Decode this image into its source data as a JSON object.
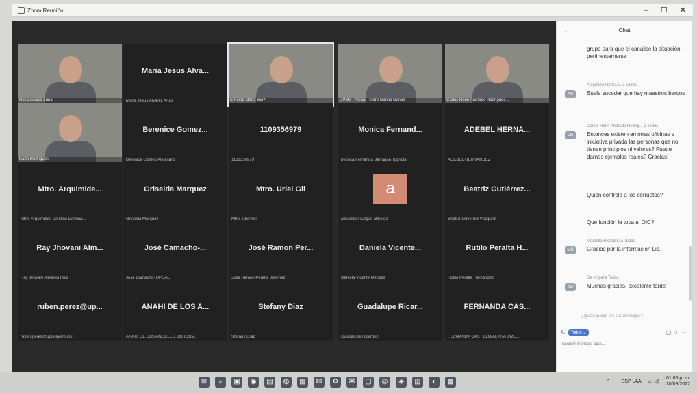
{
  "window": {
    "title": "Zoom Reunión",
    "minimize": "–",
    "maximize": "☐",
    "close": "✕"
  },
  "tiles": [
    {
      "big": "",
      "small": "Rosa Anaisa Luna",
      "video": true
    },
    {
      "big": "Maria Jesus Alva...",
      "small": "Maria Jesus Alvarez Arias",
      "video": false
    },
    {
      "big": "",
      "small": "Ernesto Mena SEP",
      "video": true,
      "active": true
    },
    {
      "big": "",
      "small": "UPSM - Alvaro Pedro Garcia Garcia",
      "video": true
    },
    {
      "big": "",
      "small": "Carlos René Andrade Rodrigues...",
      "video": true
    },
    {
      "big": "",
      "small": "Karla Rodrigues",
      "video": true
    },
    {
      "big": "Berenice Gomez...",
      "small": "Berenice Gomez Alejandro",
      "video": false
    },
    {
      "big": "1109356979",
      "small": "1109356979",
      "video": false
    },
    {
      "big": "Monica Fernand...",
      "small": "Monica Fernanda Barragan Tognola",
      "video": false
    },
    {
      "big": "ADEBEL HERNA...",
      "small": "ADEBEL HERNANDEZ",
      "video": false
    },
    {
      "big": "Mtro. Arquimide...",
      "small": "Mtro. Arquimides De Dios Domina...",
      "video": false
    },
    {
      "big": "Griselda Marquez",
      "small": "Griselda Márquez",
      "video": false
    },
    {
      "big": "Mtro. Uriel Gil",
      "small": "Mtro. Uriel Gil",
      "video": false
    },
    {
      "big": "",
      "small": "alexander vargas almeida",
      "video": false,
      "avatar": "a"
    },
    {
      "big": "Beatriz Gutiérrez...",
      "small": "Beatriz Gutiérrez Vázquez",
      "video": false
    },
    {
      "big": "Ray Jhovani Alm...",
      "small": "Ray Jhovani Almeida Ruiz",
      "video": false
    },
    {
      "big": "José Camacho-...",
      "small": "José Camacho- UPDAE",
      "video": false
    },
    {
      "big": "José Ramon Per...",
      "small": "José Ramón Peralta Jiménez",
      "video": false
    },
    {
      "big": "Daniela Vicente...",
      "small": "Daniela Vicente Méndez",
      "video": false
    },
    {
      "big": "Rutilo Peralta H...",
      "small": "Rutilo Peralta Hernández",
      "video": false
    },
    {
      "big": "ruben.perez@up...",
      "small": "ruben.perez@updelgolfo.mx",
      "video": false
    },
    {
      "big": "ANAHI DE LOS A...",
      "small": "ANAHI DE LOS ANGELES CORDOV...",
      "video": false
    },
    {
      "big": "Stefany Diaz",
      "small": "Stefany Díaz",
      "video": false
    },
    {
      "big": "Guadalupe Ricar...",
      "small": "Guadalupe Ricardez",
      "video": false
    },
    {
      "big": "FERNANDA CAS...",
      "small": "FERNANDA CASTILLO/ALPHA JIMÉ...",
      "video": false
    }
  ],
  "chat": {
    "title": "Chat",
    "messages": [
      {
        "sender": "",
        "avatar": "",
        "text": "grupo para que el canalice la situación pertinentemente"
      },
      {
        "sender": "Alejandro Utrera V. a Todos",
        "avatar": "AU",
        "text": "Suele suceder que hay maestros barcos"
      },
      {
        "sender": "Carlos Rene Andrade Rodrig... a Todos",
        "avatar": "CR",
        "text": "Entonces existen en otras oficinas e iniciativa privada las personas que no tienen principios ni valores? Puede darnos ejemplos reales? Gracias."
      },
      {
        "sender": "",
        "avatar": "",
        "text": "Quién controla a los corruptos?"
      },
      {
        "sender": "",
        "avatar": "",
        "text": "Qué función le toca al OIC?"
      },
      {
        "sender": "Marcella Ricardes a Todos",
        "avatar": "MR",
        "text": "Gracias por la información Lic."
      },
      {
        "sender": "De mi para Todos",
        "avatar": "MJ",
        "text": "Muchas gracias, excelente tarde"
      }
    ],
    "hint": "¿Quién puede ver sus mensajes?",
    "to_label": "A:",
    "to_value": "Todos ⌄",
    "tools": "▢ ☺ ···",
    "placeholder": "Escribir mensaje aquí..."
  },
  "taskbar": {
    "icons": [
      "⊞",
      "⌕",
      "▣",
      "◉",
      "▤",
      "◍",
      "▦",
      "✉",
      "⚙",
      "⌘",
      "▢",
      "◎",
      "◈",
      "▥",
      "◐",
      "▩"
    ],
    "lang": "ESP LAA",
    "time": "01:05 p. m.",
    "date": "30/09/2022"
  }
}
